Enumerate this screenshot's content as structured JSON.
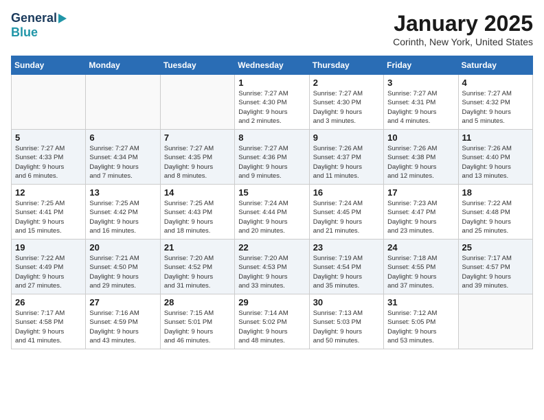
{
  "header": {
    "logo_general": "General",
    "logo_blue": "Blue",
    "title": "January 2025",
    "subtitle": "Corinth, New York, United States"
  },
  "days_of_week": [
    "Sunday",
    "Monday",
    "Tuesday",
    "Wednesday",
    "Thursday",
    "Friday",
    "Saturday"
  ],
  "weeks": [
    {
      "row_class": "row-white",
      "days": [
        {
          "date": "",
          "info": ""
        },
        {
          "date": "",
          "info": ""
        },
        {
          "date": "",
          "info": ""
        },
        {
          "date": "1",
          "info": "Sunrise: 7:27 AM\nSunset: 4:30 PM\nDaylight: 9 hours\nand 2 minutes."
        },
        {
          "date": "2",
          "info": "Sunrise: 7:27 AM\nSunset: 4:30 PM\nDaylight: 9 hours\nand 3 minutes."
        },
        {
          "date": "3",
          "info": "Sunrise: 7:27 AM\nSunset: 4:31 PM\nDaylight: 9 hours\nand 4 minutes."
        },
        {
          "date": "4",
          "info": "Sunrise: 7:27 AM\nSunset: 4:32 PM\nDaylight: 9 hours\nand 5 minutes."
        }
      ]
    },
    {
      "row_class": "row-gray",
      "days": [
        {
          "date": "5",
          "info": "Sunrise: 7:27 AM\nSunset: 4:33 PM\nDaylight: 9 hours\nand 6 minutes."
        },
        {
          "date": "6",
          "info": "Sunrise: 7:27 AM\nSunset: 4:34 PM\nDaylight: 9 hours\nand 7 minutes."
        },
        {
          "date": "7",
          "info": "Sunrise: 7:27 AM\nSunset: 4:35 PM\nDaylight: 9 hours\nand 8 minutes."
        },
        {
          "date": "8",
          "info": "Sunrise: 7:27 AM\nSunset: 4:36 PM\nDaylight: 9 hours\nand 9 minutes."
        },
        {
          "date": "9",
          "info": "Sunrise: 7:26 AM\nSunset: 4:37 PM\nDaylight: 9 hours\nand 11 minutes."
        },
        {
          "date": "10",
          "info": "Sunrise: 7:26 AM\nSunset: 4:38 PM\nDaylight: 9 hours\nand 12 minutes."
        },
        {
          "date": "11",
          "info": "Sunrise: 7:26 AM\nSunset: 4:40 PM\nDaylight: 9 hours\nand 13 minutes."
        }
      ]
    },
    {
      "row_class": "row-white",
      "days": [
        {
          "date": "12",
          "info": "Sunrise: 7:25 AM\nSunset: 4:41 PM\nDaylight: 9 hours\nand 15 minutes."
        },
        {
          "date": "13",
          "info": "Sunrise: 7:25 AM\nSunset: 4:42 PM\nDaylight: 9 hours\nand 16 minutes."
        },
        {
          "date": "14",
          "info": "Sunrise: 7:25 AM\nSunset: 4:43 PM\nDaylight: 9 hours\nand 18 minutes."
        },
        {
          "date": "15",
          "info": "Sunrise: 7:24 AM\nSunset: 4:44 PM\nDaylight: 9 hours\nand 20 minutes."
        },
        {
          "date": "16",
          "info": "Sunrise: 7:24 AM\nSunset: 4:45 PM\nDaylight: 9 hours\nand 21 minutes."
        },
        {
          "date": "17",
          "info": "Sunrise: 7:23 AM\nSunset: 4:47 PM\nDaylight: 9 hours\nand 23 minutes."
        },
        {
          "date": "18",
          "info": "Sunrise: 7:22 AM\nSunset: 4:48 PM\nDaylight: 9 hours\nand 25 minutes."
        }
      ]
    },
    {
      "row_class": "row-gray",
      "days": [
        {
          "date": "19",
          "info": "Sunrise: 7:22 AM\nSunset: 4:49 PM\nDaylight: 9 hours\nand 27 minutes."
        },
        {
          "date": "20",
          "info": "Sunrise: 7:21 AM\nSunset: 4:50 PM\nDaylight: 9 hours\nand 29 minutes."
        },
        {
          "date": "21",
          "info": "Sunrise: 7:20 AM\nSunset: 4:52 PM\nDaylight: 9 hours\nand 31 minutes."
        },
        {
          "date": "22",
          "info": "Sunrise: 7:20 AM\nSunset: 4:53 PM\nDaylight: 9 hours\nand 33 minutes."
        },
        {
          "date": "23",
          "info": "Sunrise: 7:19 AM\nSunset: 4:54 PM\nDaylight: 9 hours\nand 35 minutes."
        },
        {
          "date": "24",
          "info": "Sunrise: 7:18 AM\nSunset: 4:55 PM\nDaylight: 9 hours\nand 37 minutes."
        },
        {
          "date": "25",
          "info": "Sunrise: 7:17 AM\nSunset: 4:57 PM\nDaylight: 9 hours\nand 39 minutes."
        }
      ]
    },
    {
      "row_class": "row-white",
      "days": [
        {
          "date": "26",
          "info": "Sunrise: 7:17 AM\nSunset: 4:58 PM\nDaylight: 9 hours\nand 41 minutes."
        },
        {
          "date": "27",
          "info": "Sunrise: 7:16 AM\nSunset: 4:59 PM\nDaylight: 9 hours\nand 43 minutes."
        },
        {
          "date": "28",
          "info": "Sunrise: 7:15 AM\nSunset: 5:01 PM\nDaylight: 9 hours\nand 46 minutes."
        },
        {
          "date": "29",
          "info": "Sunrise: 7:14 AM\nSunset: 5:02 PM\nDaylight: 9 hours\nand 48 minutes."
        },
        {
          "date": "30",
          "info": "Sunrise: 7:13 AM\nSunset: 5:03 PM\nDaylight: 9 hours\nand 50 minutes."
        },
        {
          "date": "31",
          "info": "Sunrise: 7:12 AM\nSunset: 5:05 PM\nDaylight: 9 hours\nand 53 minutes."
        },
        {
          "date": "",
          "info": ""
        }
      ]
    }
  ]
}
